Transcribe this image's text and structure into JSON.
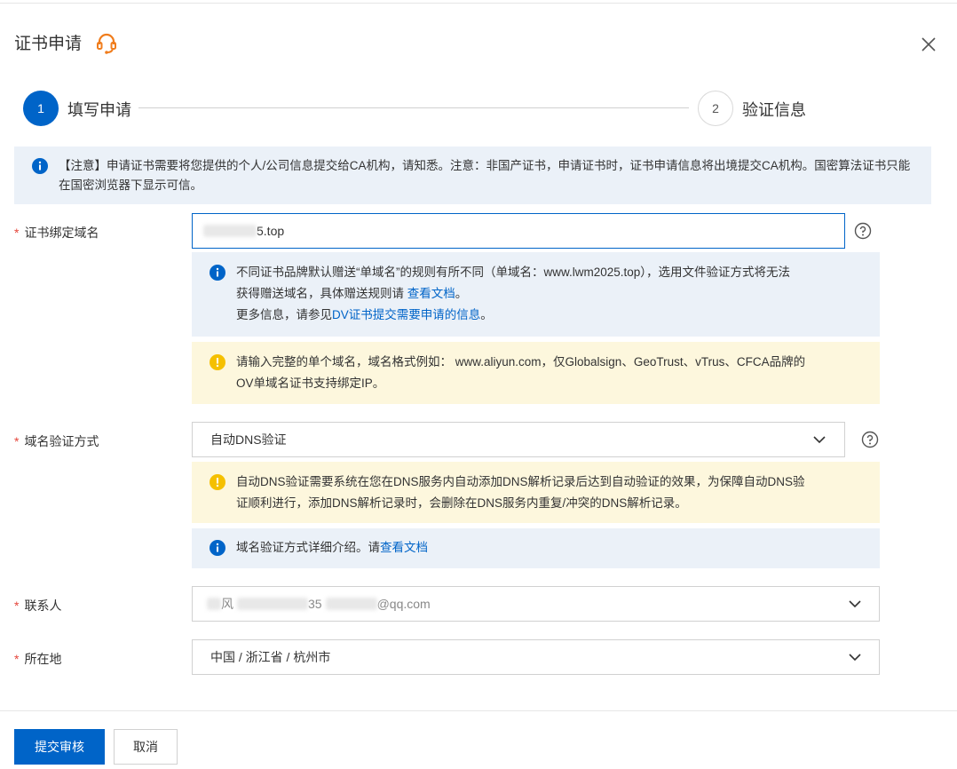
{
  "header": {
    "title": "证书申请",
    "service_icon": "customer-service-headset-icon",
    "close_icon": "close-icon"
  },
  "steps": [
    {
      "number": "1",
      "label": "填写申请",
      "active": true
    },
    {
      "number": "2",
      "label": "验证信息",
      "active": false
    }
  ],
  "notice": {
    "text": "【注意】申请证书需要将您提供的个人/公司信息提交给CA机构，请知悉。注意：非国产证书，申请证书时，证书申请信息将出境提交CA机构。国密算法证书只能在国密浏览器下显示可信。"
  },
  "domain_field": {
    "required_mark": "*",
    "label": "证书绑定域名",
    "value_visible_suffix": "5.top",
    "info_line1": "不同证书品牌默认赠送“单域名”的规则有所不同（单域名：www.lwm2025.top），选用文件验证方式将无法",
    "info_line2_prefix": "获得赠送域名，具体赠送规则请 ",
    "info_line2_link": "查看文档",
    "info_line2_suffix": "。",
    "info_line3_prefix": "更多信息，请参见",
    "info_line3_link": "DV证书提交需要申请的信息",
    "info_line3_suffix": "。",
    "warn_line1": "请输入完整的单个域名，域名格式例如： www.aliyun.com，仅Globalsign、GeoTrust、vTrus、CFCA品牌的",
    "warn_line2": "OV单域名证书支持绑定IP。"
  },
  "verify_field": {
    "required_mark": "*",
    "label": "域名验证方式",
    "selected": "自动DNS验证",
    "warn_line1": "自动DNS验证需要系统在您在DNS服务内自动添加DNS解析记录后达到自动验证的效果，为保障自动DNS验",
    "warn_line2": "证顺利进行，添加DNS解析记录时，会删除在DNS服务内重复/冲突的DNS解析记录。",
    "info_prefix": "域名验证方式详细介绍。请",
    "info_link": "查看文档"
  },
  "contact_field": {
    "required_mark": "*",
    "label": "联系人",
    "value_visible_parts": [
      "风",
      "35",
      "@qq.com"
    ]
  },
  "location_field": {
    "required_mark": "*",
    "label": "所在地",
    "selected": "中国 / 浙江省 / 杭州市"
  },
  "footer": {
    "submit_label": "提交审核",
    "cancel_label": "取消"
  },
  "colors": {
    "primary": "#0064c8",
    "required": "#e5463b",
    "info_bg": "#ebf1f8",
    "warn_bg": "#fdf7dd",
    "warn_icon": "#f5c000",
    "headset": "#f07d1d"
  }
}
